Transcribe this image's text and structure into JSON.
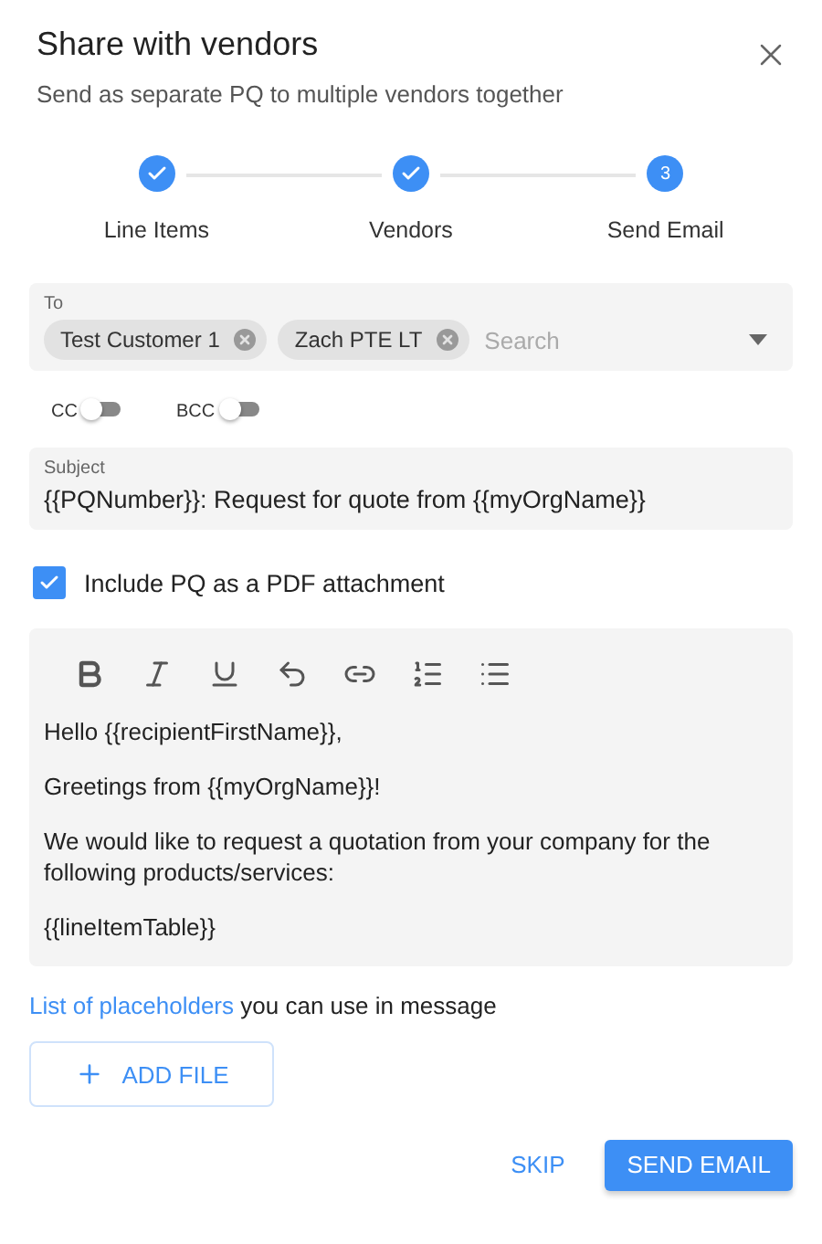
{
  "dialog": {
    "title": "Share with vendors",
    "subtitle": "Send as separate PQ to multiple vendors together"
  },
  "steps": [
    {
      "label": "Line Items",
      "completed": true
    },
    {
      "label": "Vendors",
      "completed": true
    },
    {
      "label": "Send Email",
      "number": "3",
      "completed": false
    }
  ],
  "to": {
    "label": "To",
    "recipients": [
      "Test Customer 1",
      "Zach PTE LT"
    ],
    "placeholder": "Search"
  },
  "toggles": [
    {
      "label": "CC",
      "on": false
    },
    {
      "label": "BCC",
      "on": false
    }
  ],
  "subject": {
    "label": "Subject",
    "value": "{{PQNumber}}: Request for quote from {{myOrgName}}"
  },
  "attachment": {
    "label": "Include PQ as a PDF attachment",
    "checked": true
  },
  "editor": {
    "paragraphs": [
      "Hello {{recipientFirstName}},",
      "Greetings from {{myOrgName}}!",
      "We would like to request a quotation from your company for the following products/services:",
      "{{lineItemTable}}"
    ]
  },
  "placeholders_note": {
    "link": "List of placeholders",
    "text": "you can use in message"
  },
  "add_file": "ADD FILE",
  "actions": {
    "skip": "SKIP",
    "send": "SEND EMAIL"
  }
}
